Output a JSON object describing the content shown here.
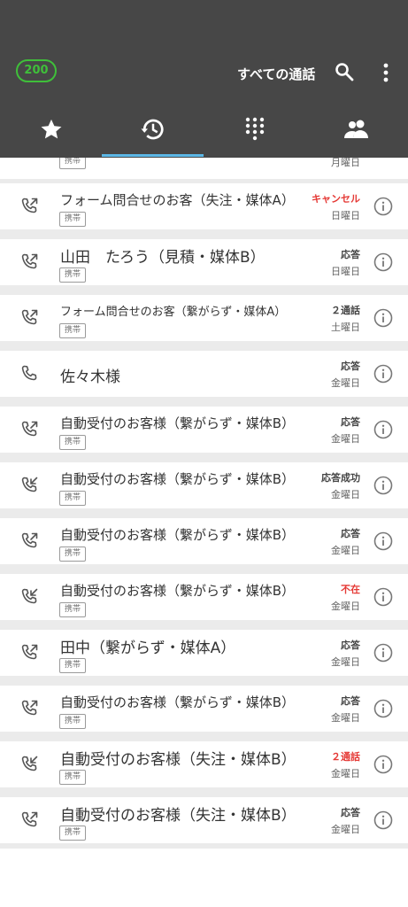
{
  "header": {
    "count_badge": "200",
    "title": "すべての通話",
    "icons": [
      "search-icon",
      "more-vert-icon"
    ],
    "tabs": [
      {
        "icon": "star-icon"
      },
      {
        "icon": "history-icon",
        "active": true
      },
      {
        "icon": "dialpad-icon"
      },
      {
        "icon": "contacts-icon"
      }
    ]
  },
  "partial_row": {
    "tag": "携帯",
    "day": "月曜日"
  },
  "calls": [
    {
      "name": "フォーム問合せのお客（失注・媒体A）",
      "tag": "携帯",
      "status": "キャンセル",
      "status_color": "red",
      "day": "日曜日",
      "direction": "outgoing",
      "size": "medium"
    },
    {
      "name": "山田　たろう（見積・媒体B）",
      "tag": "携帯",
      "status": "応答",
      "status_color": "normal",
      "day": "日曜日",
      "direction": "outgoing",
      "size": "large"
    },
    {
      "name": "フォーム問合せのお客（繋がらず・媒体A）",
      "tag": "携帯",
      "status": "２通話",
      "status_color": "normal",
      "day": "土曜日",
      "direction": "outgoing",
      "size": "small"
    },
    {
      "name": "佐々木様",
      "tag": "",
      "status": "応答",
      "status_color": "normal",
      "day": "金曜日",
      "direction": "incoming-plain",
      "size": "large"
    },
    {
      "name": "自動受付のお客様（繋がらず・媒体B）",
      "tag": "携帯",
      "status": "応答",
      "status_color": "normal",
      "day": "金曜日",
      "direction": "outgoing",
      "size": "medium"
    },
    {
      "name": "自動受付のお客様（繋がらず・媒体B）",
      "tag": "携帯",
      "status": "応答成功",
      "status_color": "normal",
      "day": "金曜日",
      "direction": "incoming",
      "size": "medium"
    },
    {
      "name": "自動受付のお客様（繋がらず・媒体B）",
      "tag": "携帯",
      "status": "応答",
      "status_color": "normal",
      "day": "金曜日",
      "direction": "outgoing",
      "size": "medium"
    },
    {
      "name": "自動受付のお客様（繋がらず・媒体B）",
      "tag": "携帯",
      "status": "不在",
      "status_color": "red",
      "day": "金曜日",
      "direction": "incoming",
      "size": "medium"
    },
    {
      "name": "田中（繋がらず・媒体A）",
      "tag": "携帯",
      "status": "応答",
      "status_color": "normal",
      "day": "金曜日",
      "direction": "outgoing",
      "size": "large"
    },
    {
      "name": "自動受付のお客様（繋がらず・媒体B）",
      "tag": "携帯",
      "status": "応答",
      "status_color": "normal",
      "day": "金曜日",
      "direction": "outgoing",
      "size": "medium"
    },
    {
      "name": "自動受付のお客様（失注・媒体B）",
      "tag": "携帯",
      "status": "２通話",
      "status_color": "red",
      "day": "金曜日",
      "direction": "incoming",
      "size": "large"
    },
    {
      "name": "自動受付のお客様（失注・媒体B）",
      "tag": "携帯",
      "status": "応答",
      "status_color": "normal",
      "day": "金曜日",
      "direction": "outgoing",
      "size": "large"
    }
  ],
  "colors": {
    "header_bg": "#474747",
    "accent_green": "#3fbf3a",
    "tab_indicator": "#5bb7e6",
    "missed_red": "#e53935"
  }
}
